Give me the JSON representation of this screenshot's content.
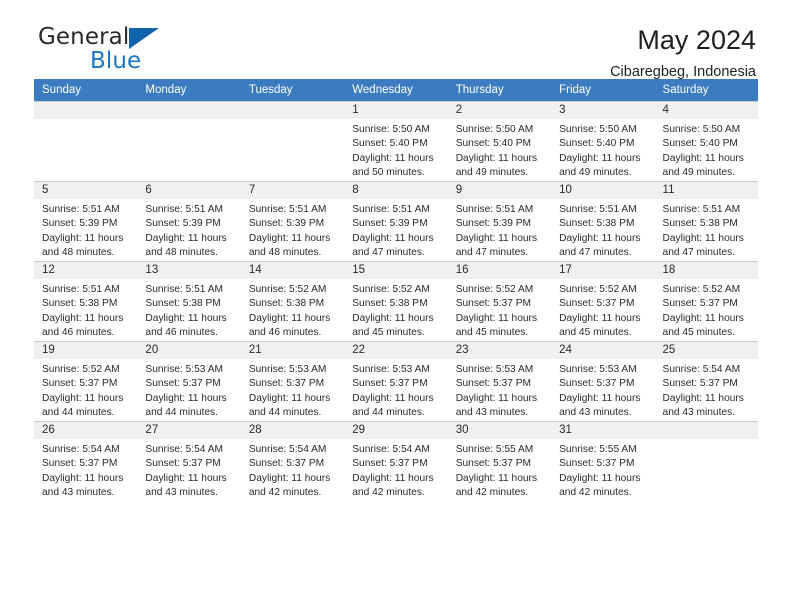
{
  "brand": {
    "name_part1": "General",
    "name_part2": "Blue",
    "accent_color": "#1b76c3",
    "triangle_color": "#1064ad"
  },
  "header": {
    "month_title": "May 2024",
    "location": "Cibaregbeg, Indonesia"
  },
  "calendar": {
    "header_bg": "#3b7cc0",
    "header_text_color": "#ffffff",
    "daynum_bg": "#f0f0f0",
    "weekday_headers": [
      "Sunday",
      "Monday",
      "Tuesday",
      "Wednesday",
      "Thursday",
      "Friday",
      "Saturday"
    ],
    "labels": {
      "sunrise_prefix": "Sunrise: ",
      "sunset_prefix": "Sunset: ",
      "daylight_prefix": "Daylight: "
    },
    "weeks": [
      [
        {
          "day": "",
          "empty": true
        },
        {
          "day": "",
          "empty": true
        },
        {
          "day": "",
          "empty": true
        },
        {
          "day": "1",
          "sunrise": "Sunrise: 5:50 AM",
          "sunset": "Sunset: 5:40 PM",
          "daylight": "Daylight: 11 hours and 50 minutes."
        },
        {
          "day": "2",
          "sunrise": "Sunrise: 5:50 AM",
          "sunset": "Sunset: 5:40 PM",
          "daylight": "Daylight: 11 hours and 49 minutes."
        },
        {
          "day": "3",
          "sunrise": "Sunrise: 5:50 AM",
          "sunset": "Sunset: 5:40 PM",
          "daylight": "Daylight: 11 hours and 49 minutes."
        },
        {
          "day": "4",
          "sunrise": "Sunrise: 5:50 AM",
          "sunset": "Sunset: 5:40 PM",
          "daylight": "Daylight: 11 hours and 49 minutes."
        }
      ],
      [
        {
          "day": "5",
          "sunrise": "Sunrise: 5:51 AM",
          "sunset": "Sunset: 5:39 PM",
          "daylight": "Daylight: 11 hours and 48 minutes."
        },
        {
          "day": "6",
          "sunrise": "Sunrise: 5:51 AM",
          "sunset": "Sunset: 5:39 PM",
          "daylight": "Daylight: 11 hours and 48 minutes."
        },
        {
          "day": "7",
          "sunrise": "Sunrise: 5:51 AM",
          "sunset": "Sunset: 5:39 PM",
          "daylight": "Daylight: 11 hours and 48 minutes."
        },
        {
          "day": "8",
          "sunrise": "Sunrise: 5:51 AM",
          "sunset": "Sunset: 5:39 PM",
          "daylight": "Daylight: 11 hours and 47 minutes."
        },
        {
          "day": "9",
          "sunrise": "Sunrise: 5:51 AM",
          "sunset": "Sunset: 5:39 PM",
          "daylight": "Daylight: 11 hours and 47 minutes."
        },
        {
          "day": "10",
          "sunrise": "Sunrise: 5:51 AM",
          "sunset": "Sunset: 5:38 PM",
          "daylight": "Daylight: 11 hours and 47 minutes."
        },
        {
          "day": "11",
          "sunrise": "Sunrise: 5:51 AM",
          "sunset": "Sunset: 5:38 PM",
          "daylight": "Daylight: 11 hours and 47 minutes."
        }
      ],
      [
        {
          "day": "12",
          "sunrise": "Sunrise: 5:51 AM",
          "sunset": "Sunset: 5:38 PM",
          "daylight": "Daylight: 11 hours and 46 minutes."
        },
        {
          "day": "13",
          "sunrise": "Sunrise: 5:51 AM",
          "sunset": "Sunset: 5:38 PM",
          "daylight": "Daylight: 11 hours and 46 minutes."
        },
        {
          "day": "14",
          "sunrise": "Sunrise: 5:52 AM",
          "sunset": "Sunset: 5:38 PM",
          "daylight": "Daylight: 11 hours and 46 minutes."
        },
        {
          "day": "15",
          "sunrise": "Sunrise: 5:52 AM",
          "sunset": "Sunset: 5:38 PM",
          "daylight": "Daylight: 11 hours and 45 minutes."
        },
        {
          "day": "16",
          "sunrise": "Sunrise: 5:52 AM",
          "sunset": "Sunset: 5:37 PM",
          "daylight": "Daylight: 11 hours and 45 minutes."
        },
        {
          "day": "17",
          "sunrise": "Sunrise: 5:52 AM",
          "sunset": "Sunset: 5:37 PM",
          "daylight": "Daylight: 11 hours and 45 minutes."
        },
        {
          "day": "18",
          "sunrise": "Sunrise: 5:52 AM",
          "sunset": "Sunset: 5:37 PM",
          "daylight": "Daylight: 11 hours and 45 minutes."
        }
      ],
      [
        {
          "day": "19",
          "sunrise": "Sunrise: 5:52 AM",
          "sunset": "Sunset: 5:37 PM",
          "daylight": "Daylight: 11 hours and 44 minutes."
        },
        {
          "day": "20",
          "sunrise": "Sunrise: 5:53 AM",
          "sunset": "Sunset: 5:37 PM",
          "daylight": "Daylight: 11 hours and 44 minutes."
        },
        {
          "day": "21",
          "sunrise": "Sunrise: 5:53 AM",
          "sunset": "Sunset: 5:37 PM",
          "daylight": "Daylight: 11 hours and 44 minutes."
        },
        {
          "day": "22",
          "sunrise": "Sunrise: 5:53 AM",
          "sunset": "Sunset: 5:37 PM",
          "daylight": "Daylight: 11 hours and 44 minutes."
        },
        {
          "day": "23",
          "sunrise": "Sunrise: 5:53 AM",
          "sunset": "Sunset: 5:37 PM",
          "daylight": "Daylight: 11 hours and 43 minutes."
        },
        {
          "day": "24",
          "sunrise": "Sunrise: 5:53 AM",
          "sunset": "Sunset: 5:37 PM",
          "daylight": "Daylight: 11 hours and 43 minutes."
        },
        {
          "day": "25",
          "sunrise": "Sunrise: 5:54 AM",
          "sunset": "Sunset: 5:37 PM",
          "daylight": "Daylight: 11 hours and 43 minutes."
        }
      ],
      [
        {
          "day": "26",
          "sunrise": "Sunrise: 5:54 AM",
          "sunset": "Sunset: 5:37 PM",
          "daylight": "Daylight: 11 hours and 43 minutes."
        },
        {
          "day": "27",
          "sunrise": "Sunrise: 5:54 AM",
          "sunset": "Sunset: 5:37 PM",
          "daylight": "Daylight: 11 hours and 43 minutes."
        },
        {
          "day": "28",
          "sunrise": "Sunrise: 5:54 AM",
          "sunset": "Sunset: 5:37 PM",
          "daylight": "Daylight: 11 hours and 42 minutes."
        },
        {
          "day": "29",
          "sunrise": "Sunrise: 5:54 AM",
          "sunset": "Sunset: 5:37 PM",
          "daylight": "Daylight: 11 hours and 42 minutes."
        },
        {
          "day": "30",
          "sunrise": "Sunrise: 5:55 AM",
          "sunset": "Sunset: 5:37 PM",
          "daylight": "Daylight: 11 hours and 42 minutes."
        },
        {
          "day": "31",
          "sunrise": "Sunrise: 5:55 AM",
          "sunset": "Sunset: 5:37 PM",
          "daylight": "Daylight: 11 hours and 42 minutes."
        },
        {
          "day": "",
          "empty": true
        }
      ]
    ]
  }
}
